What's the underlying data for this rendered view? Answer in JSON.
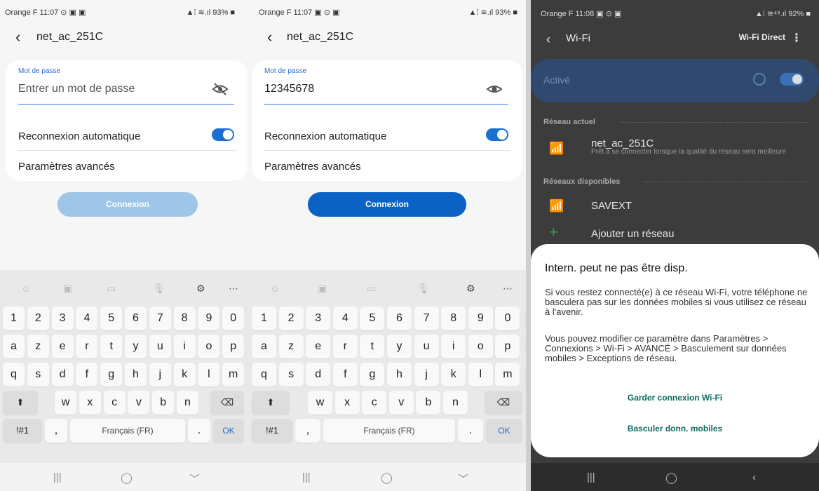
{
  "screen1": {
    "status_left": "Orange F 11:07 ⊙ ▣ ▣",
    "status_right": "▲⁞ ≋.ıl 93% ■",
    "title": "net_ac_251C",
    "password_label": "Mot de passe",
    "password_placeholder": "Entrer un mot de passe",
    "auto_reconnect_label": "Reconnexion automatique",
    "advanced_label": "Paramètres avancés",
    "connect_label": "Connexion"
  },
  "screen2": {
    "status_left": "Orange F 11:07 ▣ ⊙ ▣",
    "status_right": "▲⁞ ≋.ıl 93% ■",
    "title": "net_ac_251C",
    "password_label": "Mot de passe",
    "password_value": "12345678",
    "auto_reconnect_label": "Reconnexion automatique",
    "advanced_label": "Paramètres avancés",
    "connect_label": "Connexion"
  },
  "keyboard": {
    "digits": [
      "1",
      "2",
      "3",
      "4",
      "5",
      "6",
      "7",
      "8",
      "9",
      "0"
    ],
    "row1": [
      "a",
      "z",
      "e",
      "r",
      "t",
      "y",
      "u",
      "i",
      "o",
      "p"
    ],
    "row2": [
      "q",
      "s",
      "d",
      "f",
      "g",
      "h",
      "j",
      "k",
      "l",
      "m"
    ],
    "row3": [
      "w",
      "x",
      "c",
      "v",
      "b",
      "n"
    ],
    "symbols_label": "!#1",
    "comma": ",",
    "space_label": "Français (FR)",
    "period": ".",
    "ok_label": "OK"
  },
  "screen3": {
    "status_left": "Orange F 11:08 ▣ ⊙ ▣",
    "status_right": "▲⁞ ≋⁴⁹.ıl 92% ■",
    "title": "Wi-Fi",
    "wifi_direct_label": "Wi-Fi Direct",
    "active_label": "Activé",
    "current_network_header": "Réseau actuel",
    "current_network_name": "net_ac_251C",
    "current_network_desc": "Prêt à se connecter lorsque la qualité du réseau sera meilleure",
    "available_networks_header": "Réseaux disponibles",
    "available_network_name": "SAVEXT",
    "add_network_label": "Ajouter un réseau",
    "dialog": {
      "title": "Intern. peut ne pas être disp.",
      "body1": "Si vous restez connecté(e) à ce réseau Wi-Fi, votre téléphone ne basculera pas sur les données mobiles si vous utilisez ce réseau à l'avenir.",
      "body2": "Vous pouvez modifier ce paramètre dans Paramètres > Connexions > Wi-Fi > AVANCÉ > Basculement sur données mobiles > Exceptions de réseau.",
      "keep_wifi_label": "Garder connexion Wi-Fi",
      "switch_mobile_label": "Basculer donn. mobiles"
    }
  },
  "colors": {
    "accent": "#1b6fd1",
    "connect_disabled": "#9fc5e8",
    "connect_enabled": "#0a63c4",
    "dialog_button": "#0d6d62"
  }
}
